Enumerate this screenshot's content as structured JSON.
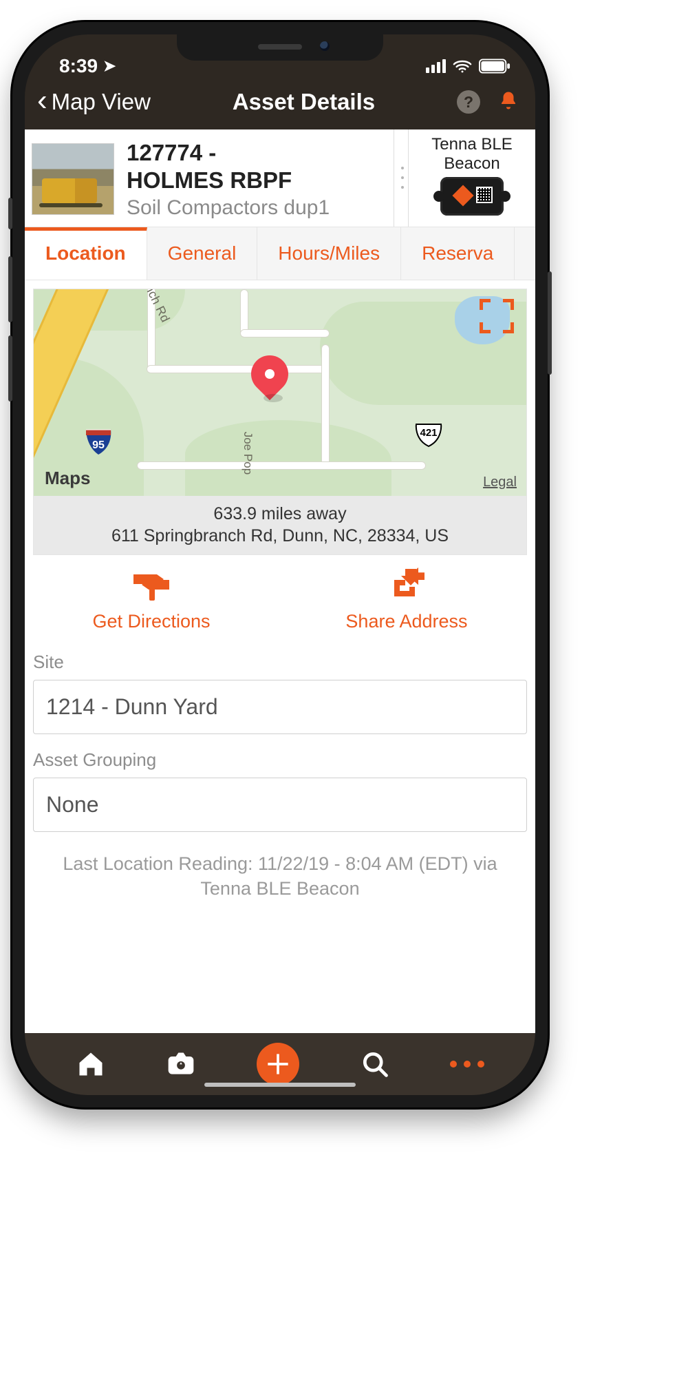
{
  "statusbar": {
    "time": "8:39"
  },
  "navbar": {
    "back_label": "Map View",
    "title": "Asset Details"
  },
  "asset": {
    "title_line1": "127774 -",
    "title_line2": "HOLMES RBPF",
    "category": "Soil Compactors dup1",
    "tracker_line1": "Tenna BLE",
    "tracker_line2": "Beacon"
  },
  "tabs": [
    {
      "label": "Location",
      "active": true
    },
    {
      "label": "General"
    },
    {
      "label": "Hours/Miles"
    },
    {
      "label": "Reserva"
    }
  ],
  "map": {
    "provider": "Maps",
    "legal": "Legal",
    "road_label_1": "nch Rd",
    "road_label_2": "Joe Pop",
    "shield_i95": "95",
    "shield_us421": "421",
    "distance_line": "633.9 miles away",
    "address_line": "611 Springbranch Rd, Dunn, NC, 28334, US"
  },
  "actions": {
    "directions": "Get Directions",
    "share": "Share Address"
  },
  "fields": {
    "site_label": "Site",
    "site_value": "1214 - Dunn Yard",
    "grouping_label": "Asset Grouping",
    "grouping_value": "None"
  },
  "footer": {
    "last_reading_line1": "Last Location Reading: 11/22/19 - 8:04 AM  (EDT) via",
    "last_reading_line2": "Tenna BLE Beacon"
  }
}
